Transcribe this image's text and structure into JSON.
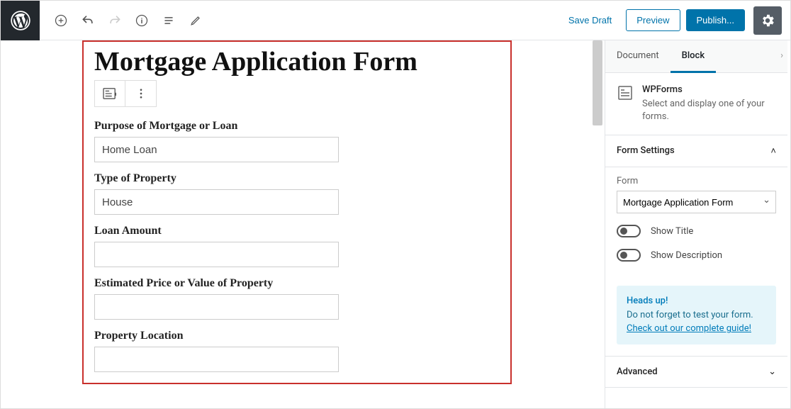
{
  "toolbar": {
    "save_draft": "Save Draft",
    "preview": "Preview",
    "publish": "Publish..."
  },
  "form": {
    "title": "Mortgage Application Form",
    "fields": [
      {
        "label": "Purpose of Mortgage or Loan",
        "value": "Home Loan"
      },
      {
        "label": "Type of Property",
        "value": "House"
      },
      {
        "label": "Loan Amount",
        "value": ""
      },
      {
        "label": "Estimated Price or Value of Property",
        "value": ""
      },
      {
        "label": "Property Location",
        "value": ""
      }
    ]
  },
  "sidebar": {
    "tabs": {
      "document": "Document",
      "block": "Block"
    },
    "block_info": {
      "name": "WPForms",
      "desc": "Select and display one of your forms."
    },
    "form_settings": {
      "heading": "Form Settings",
      "form_label": "Form",
      "form_value": "Mortgage Application Form",
      "show_title": "Show Title",
      "show_description": "Show Description"
    },
    "notice": {
      "heads": "Heads up!",
      "text": "Do not forget to test your form.",
      "link": "Check out our complete guide!"
    },
    "advanced": "Advanced"
  }
}
